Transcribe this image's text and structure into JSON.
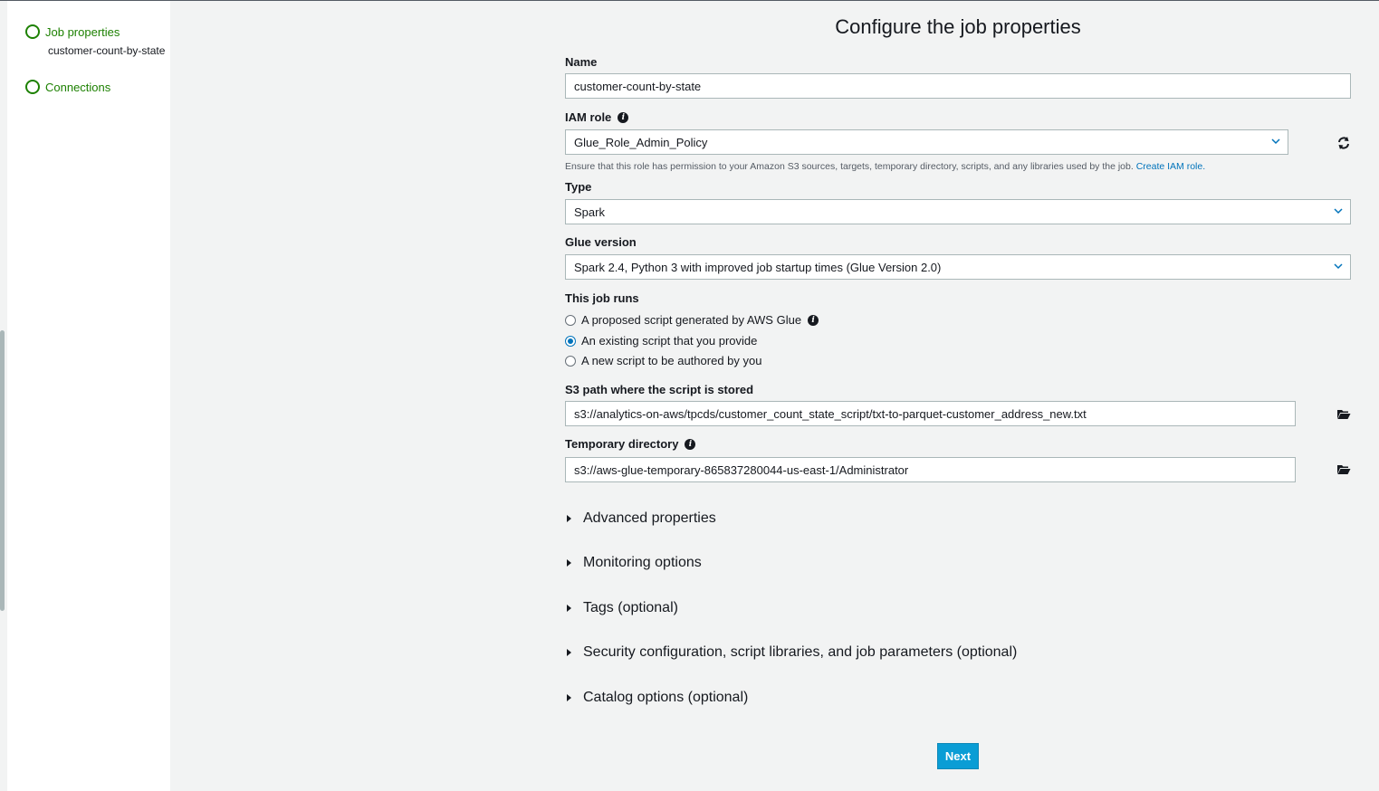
{
  "sidebar": {
    "steps": [
      {
        "label": "Job properties",
        "sub": "customer-count-by-state"
      },
      {
        "label": "Connections"
      }
    ]
  },
  "main": {
    "title": "Configure the job properties",
    "name": {
      "label": "Name",
      "value": "customer-count-by-state"
    },
    "iam_role": {
      "label": "IAM role",
      "value": "Glue_Role_Admin_Policy",
      "hint": "Ensure that this role has permission to your Amazon S3 sources, targets, temporary directory, scripts, and any libraries used by the job.",
      "link": "Create IAM role."
    },
    "type": {
      "label": "Type",
      "value": "Spark"
    },
    "glue_version": {
      "label": "Glue version",
      "value": "Spark 2.4, Python 3 with improved job startup times (Glue Version 2.0)"
    },
    "job_runs": {
      "label": "This job runs",
      "options": [
        {
          "label": "A proposed script generated by AWS Glue",
          "checked": false
        },
        {
          "label": "An existing script that you provide",
          "checked": true
        },
        {
          "label": "A new script to be authored by you",
          "checked": false
        }
      ]
    },
    "s3_path": {
      "label": "S3 path where the script is stored",
      "value": "s3://analytics-on-aws/tpcds/customer_count_state_script/txt-to-parquet-customer_address_new.txt"
    },
    "temp_dir": {
      "label": "Temporary directory",
      "value": "s3://aws-glue-temporary-865837280044-us-east-1/Administrator"
    },
    "sections": [
      "Advanced properties",
      "Monitoring options",
      "Tags (optional)",
      "Security configuration, script libraries, and job parameters (optional)",
      "Catalog options (optional)"
    ],
    "next_label": "Next"
  },
  "colors": {
    "accent": "#0a9dd5",
    "step_green": "#1d8102",
    "link": "#0073bb"
  },
  "icons": [
    "info-icon",
    "refresh-icon",
    "folder-icon",
    "chevron-down-icon",
    "caret-right-icon"
  ]
}
